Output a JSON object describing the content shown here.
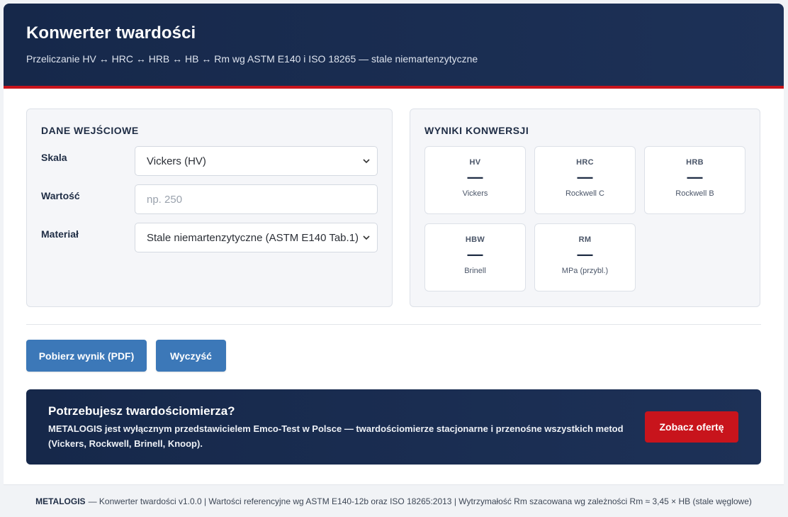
{
  "header": {
    "title": "Konwerter twardości",
    "subtitle": "Przeliczanie HV ↔ HRC ↔ HRB ↔ HB ↔ Rm wg ASTM E140 i ISO 18265 — stale niemartenzytyczne"
  },
  "input_panel": {
    "title": "DANE WEJŚCIOWE",
    "scale": {
      "label": "Skala",
      "selected": "Vickers (HV)"
    },
    "value": {
      "label": "Wartość",
      "value": "",
      "placeholder": "np. 250"
    },
    "material": {
      "label": "Materiał",
      "selected": "Stale niemartenzytyczne (ASTM E140 Tab.1)"
    }
  },
  "results_panel": {
    "title": "WYNIKI KONWERSJI",
    "cards": [
      {
        "code": "HV",
        "value": "—",
        "desc": "Vickers"
      },
      {
        "code": "HRC",
        "value": "—",
        "desc": "Rockwell C"
      },
      {
        "code": "HRB",
        "value": "—",
        "desc": "Rockwell B"
      },
      {
        "code": "HBW",
        "value": "—",
        "desc": "Brinell"
      },
      {
        "code": "RM",
        "value": "—",
        "desc": "MPa (przybl.)"
      }
    ]
  },
  "actions": {
    "pdf_label": "Pobierz wynik (PDF)",
    "clear_label": "Wyczyść"
  },
  "promo": {
    "title": "Potrzebujesz twardościomierza?",
    "text": "METALOGIS jest wyłącznym przedstawicielem Emco-Test w Polsce — twardościomierze stacjonarne i przenośne wszystkich metod (Vickers, Rockwell, Brinell, Knoop).",
    "cta_label": "Zobacz ofertę"
  },
  "footer": {
    "brand": "METALOGIS",
    "text": "— Konwerter twardości v1.0.0 | Wartości referencyjne wg ASTM E140-12b oraz ISO 18265:2013 | Wytrzymałość Rm szacowana wg zależności Rm ≈ 3,45 × HB (stale węglowe)"
  },
  "colors": {
    "header_bg": "#16284a",
    "accent_red": "#c8141c",
    "button_blue": "#3c78b8"
  }
}
